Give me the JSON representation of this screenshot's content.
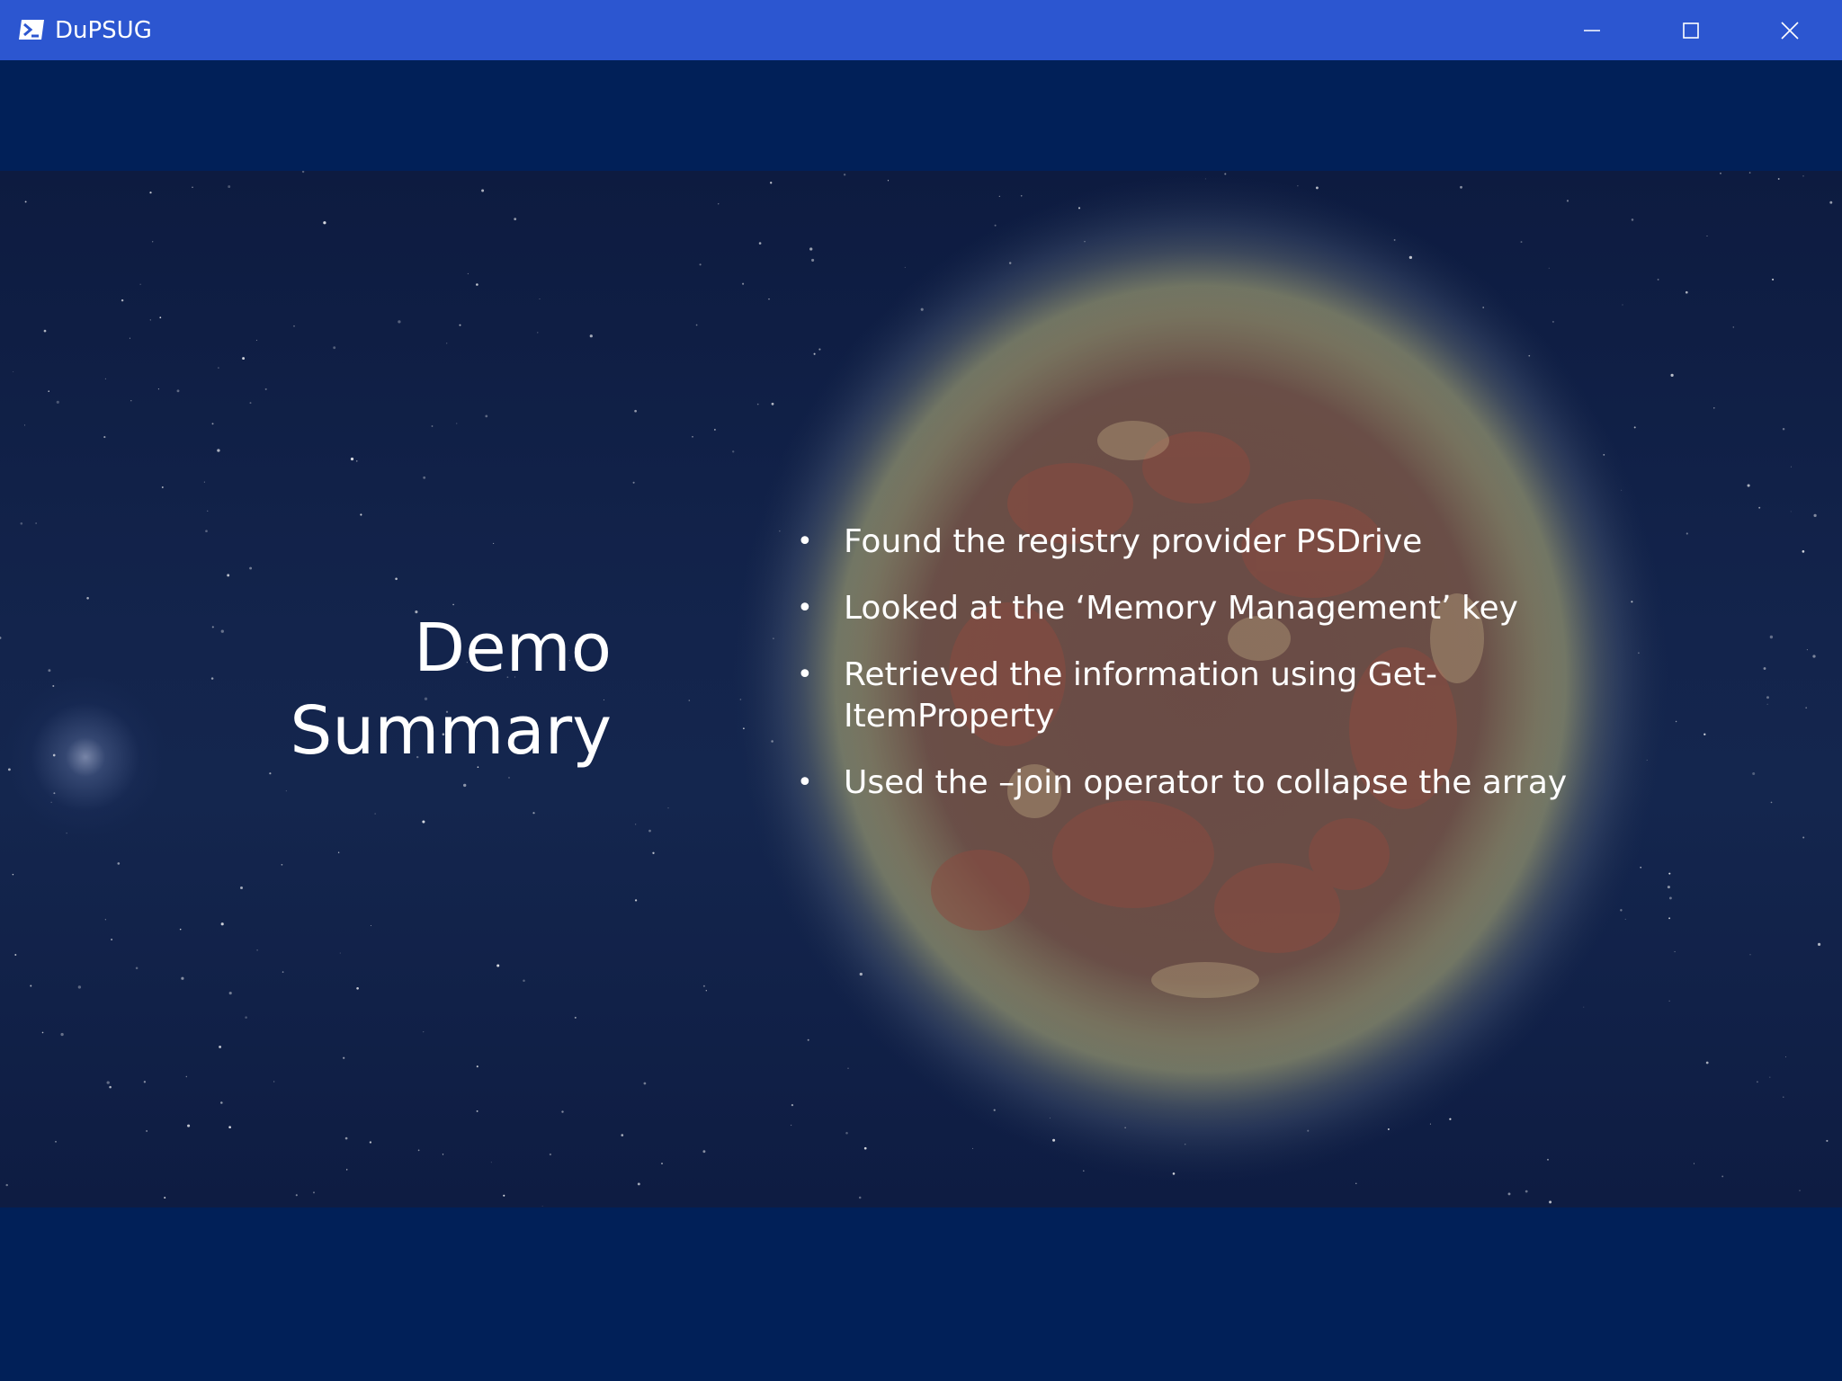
{
  "window": {
    "title": "DuPSUG",
    "icon": "powershell-icon",
    "controls": {
      "minimize_icon": "minimize-icon",
      "maximize_icon": "maximize-icon",
      "close_icon": "close-icon"
    },
    "titlebar_color": "#2c56d0",
    "background_color": "#012058"
  },
  "slide": {
    "title_line1": "Demo",
    "title_line2": "Summary",
    "bullets": [
      "Found the registry provider PSDrive",
      "Looked at the ‘Memory Management’ key",
      "Retrieved the information using Get-ItemProperty",
      "Used the –join operator to collapse the array"
    ],
    "bullet_glyph": "•",
    "text_color": "#ffffff"
  }
}
